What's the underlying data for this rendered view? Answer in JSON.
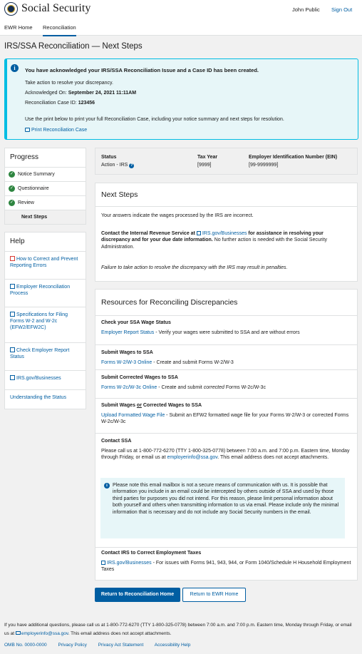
{
  "header": {
    "brand": "Social Security",
    "user_name": "John Public",
    "sign_out": "Sign Out"
  },
  "nav": {
    "items": [
      "EWR Home",
      "Reconciliation"
    ]
  },
  "page_title": "IRS/SSA Reconciliation — Next Steps",
  "alert": {
    "title": "You have acknowledged your IRS/SSA Reconciliation Issue and a Case ID has been created.",
    "take_action": "Take action to resolve your discrepancy.",
    "ack_label": "Acknowledged On:",
    "ack_value": "September 24, 2021 11:11AM",
    "case_label": "Reconciliation Case ID:",
    "case_value": "123456",
    "print_text": "Use the print below to print your full Reconciliation Case, including your notice summary and next steps for resolution.",
    "print_link": "Print Reconciliation Case"
  },
  "progress": {
    "heading": "Progress",
    "items": [
      "Notice Summary",
      "Questionnaire",
      "Review",
      "Next Steps"
    ]
  },
  "help": {
    "heading": "Help",
    "items": [
      "How to Correct and Prevent Reporting Errors",
      "Employer Reconciliation Process",
      "Specifications for Filing Forms W-2 and W-2c (EFW2/EFW2C)",
      "Check Employer Report Status",
      "IRS.gov/Businesses",
      "Understanding the Status"
    ]
  },
  "status": {
    "status_h": "Status",
    "status_v": "Action - IRS",
    "tax_h": "Tax Year",
    "tax_v": "[9999]",
    "ein_h": "Employer Identification Number (EIN)",
    "ein_v": "[99-9999999]"
  },
  "next_steps": {
    "heading": "Next Steps",
    "p1": "Your answers indicate the wages processed by the IRS are incorrect.",
    "contact_pre": "Contact the Internal Revenue Service at ",
    "contact_link": "IRS.gov/Businesses",
    "contact_post": " for assistance in resolving your discrepancy and for your due date information.",
    "contact_tail": " No further action is needed with the Social Security Administration.",
    "failure": "Failure to take action to resolve the discrepancy with the IRS may result in penalties."
  },
  "resources": {
    "heading": "Resources for Reconciling Discrepancies",
    "check_h": "Check your SSA Wage Status",
    "check_link": "Employer Report Status",
    "check_t": " - Verify your wages were submitted to SSA and are without errors",
    "submit_h": "Submit Wages to SSA",
    "submit_link": "Forms  W-2/W-3 Online",
    "submit_t": " - Create and submit Forms W-2/W-3",
    "corr_h": "Submit Corrected Wages to SSA",
    "corr_link": "Forms  W-2c/W-3c Online",
    "corr_t1": " - Create and submit ",
    "corr_em": "corrected",
    "corr_t2": " Forms W-2c/W-3c",
    "upload_h1": "Submit Wages ",
    "upload_h_or": "or",
    "upload_h2": " Corrected Wages to SSA",
    "upload_link": "Upload Formatted Wage File",
    "upload_t": " - Submit an EFW2 formatted wage file for your Forms W-2/W-3 or corrected Forms W-2c/W-3c",
    "contact_h": "Contact SSA",
    "contact_t1": "Please call us at 1-800-772-6270 (TTY 1-800-325-0778) between 7:00 a.m. and 7:00 p.m. Eastern time, Monday through Friday, or email us at ",
    "contact_email": "employerinfo@ssa.gov",
    "contact_t2": ". This email address does not accept attachments.",
    "notice": "Please note this email mailbox is not a secure means of communication with us. It is possible that information you include in an email could be intercepted by others outside of SSA and used by those third parties for purposes you did not intend. For this reason, please limit personal information about both yourself and others when transmitting information to us via email.  Please include only the minimal information that is necessary and do not include any Social Security numbers in the email.",
    "irs_h": "Contact IRS to Correct Employment Taxes",
    "irs_link": "IRS.gov/Businesses",
    "irs_t": " - For issues with Forms 941, 943, 944, or Form 1040/Schedule H Household Employment Taxes"
  },
  "buttons": {
    "primary": "Return to Reconciliation Home",
    "secondary": "Return to EWR Home"
  },
  "footer": {
    "t1": "If you have additional questions, please call us at 1-800-772-6270 (TTY 1-800-325-0778) between 7:00 a.m. and 7:00 p.m. Eastern time, Monday through Friday, or email us at ",
    "email": "employerinfo@ssa.gov",
    "t2": ". This email address does not accept attachments.",
    "links": [
      "OMB No. 0000-0000",
      "Privacy Policy",
      "Privacy Act Statement",
      "Accessibility Help"
    ]
  }
}
